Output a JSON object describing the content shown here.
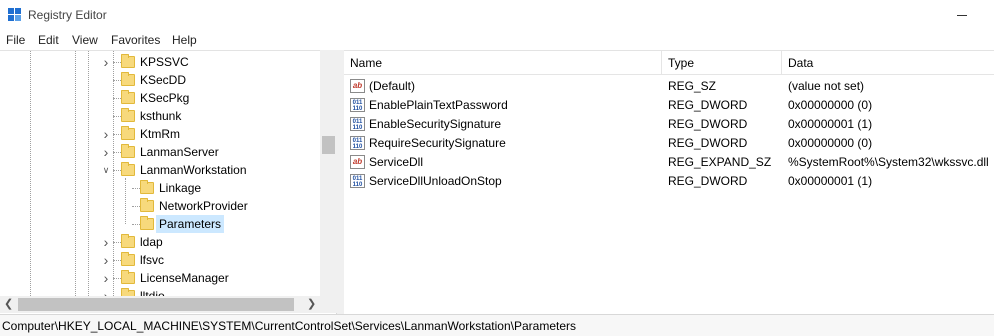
{
  "window": {
    "title": "Registry Editor",
    "icon": "registry-editor-icon"
  },
  "menu": [
    "File",
    "Edit",
    "View",
    "Favorites",
    "Help"
  ],
  "tree": {
    "items": [
      {
        "label": "KPSSVC",
        "expander": "collapsed",
        "depth": 0
      },
      {
        "label": "KSecDD",
        "expander": "none",
        "depth": 0
      },
      {
        "label": "KSecPkg",
        "expander": "none",
        "depth": 0
      },
      {
        "label": "ksthunk",
        "expander": "none",
        "depth": 0
      },
      {
        "label": "KtmRm",
        "expander": "collapsed",
        "depth": 0
      },
      {
        "label": "LanmanServer",
        "expander": "collapsed",
        "depth": 0
      },
      {
        "label": "LanmanWorkstation",
        "expander": "expanded",
        "depth": 0
      },
      {
        "label": "Linkage",
        "expander": "none",
        "depth": 1
      },
      {
        "label": "NetworkProvider",
        "expander": "none",
        "depth": 1
      },
      {
        "label": "Parameters",
        "expander": "none",
        "depth": 1,
        "selected": true
      },
      {
        "label": "ldap",
        "expander": "collapsed",
        "depth": 0
      },
      {
        "label": "lfsvc",
        "expander": "collapsed",
        "depth": 0
      },
      {
        "label": "LicenseManager",
        "expander": "collapsed",
        "depth": 0
      },
      {
        "label": "lltdio",
        "expander": "collapsed",
        "depth": 0
      }
    ]
  },
  "list": {
    "columns": [
      "Name",
      "Type",
      "Data"
    ],
    "rows": [
      {
        "icon": "string-value-icon",
        "name": "(Default)",
        "type": "REG_SZ",
        "data": "(value not set)"
      },
      {
        "icon": "dword-value-icon",
        "name": "EnablePlainTextPassword",
        "type": "REG_DWORD",
        "data": "0x00000000 (0)"
      },
      {
        "icon": "dword-value-icon",
        "name": "EnableSecuritySignature",
        "type": "REG_DWORD",
        "data": "0x00000001 (1)"
      },
      {
        "icon": "dword-value-icon",
        "name": "RequireSecuritySignature",
        "type": "REG_DWORD",
        "data": "0x00000000 (0)"
      },
      {
        "icon": "string-value-icon",
        "name": "ServiceDll",
        "type": "REG_EXPAND_SZ",
        "data": "%SystemRoot%\\System32\\wkssvc.dll"
      },
      {
        "icon": "dword-value-icon",
        "name": "ServiceDllUnloadOnStop",
        "type": "REG_DWORD",
        "data": "0x00000001 (1)"
      }
    ]
  },
  "status": {
    "path": "Computer\\HKEY_LOCAL_MACHINE\\SYSTEM\\CurrentControlSet\\Services\\LanmanWorkstation\\Parameters"
  },
  "colors": {
    "selection": "#cce8ff",
    "folder": "#f7d97c",
    "string_icon": "#c0392b",
    "dword_icon": "#1f4fa0"
  }
}
